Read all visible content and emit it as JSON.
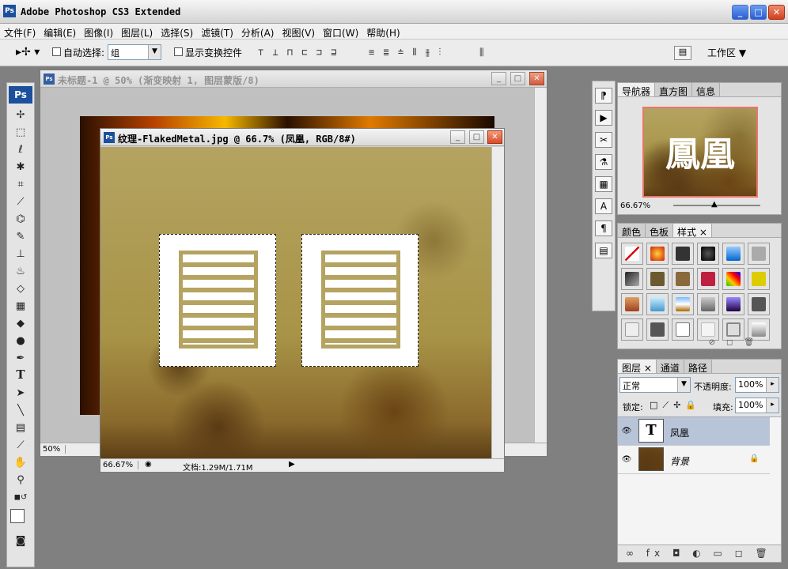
{
  "app": {
    "title": "Adobe Photoshop CS3 Extended",
    "logo": "Ps"
  },
  "window_controls": {
    "minimize": "_",
    "maximize": "□",
    "close": "✕"
  },
  "menu": [
    "文件(F)",
    "编辑(E)",
    "图像(I)",
    "图层(L)",
    "选择(S)",
    "滤镜(T)",
    "分析(A)",
    "视图(V)",
    "窗口(W)",
    "帮助(H)"
  ],
  "options": {
    "auto_select_label": "自动选择:",
    "auto_select_value": "组",
    "show_transform_label": "显示变换控件",
    "workspace_label": "工作区 ▼",
    "align_icons": "⊤ ⊥ ⊓  ⊏ ⊐ ⊒",
    "distribute_icons": "≡ ≣ ≐  ⫴ ⫵ ⫶"
  },
  "doc_back": {
    "title": "未标题-1 @ 50% (渐变映射 1, 图层蒙版/8)",
    "zoom": "50%"
  },
  "doc_front": {
    "title": "纹理-FlakedMetal.jpg @ 66.7% (凤凰, RGB/8#)",
    "zoom": "66.67%",
    "doc_info": "文档:1.29M/1.71M",
    "chars": [
      "凰",
      "凰"
    ]
  },
  "navigator": {
    "tabs": [
      "导航器",
      "直方图",
      "信息"
    ],
    "zoom": "66.67%",
    "thumb_text": "鳳凰"
  },
  "swatches_panel": {
    "tabs": [
      "颜色",
      "色板",
      "样式"
    ],
    "close_x": "×"
  },
  "layers_panel": {
    "tabs": [
      "图层",
      "通道",
      "路径"
    ],
    "close_x": "×",
    "blend_mode": "正常",
    "opacity_label": "不透明度:",
    "opacity_value": "100%",
    "lock_label": "锁定:",
    "fill_label": "填充:",
    "fill_value": "100%",
    "layers": [
      {
        "name": "凤凰",
        "thumb": "T"
      },
      {
        "name": "背景",
        "thumb": ""
      }
    ],
    "footer_icons": "∞ fx ◘ ◐ ▭ ◻ 🗑"
  },
  "colors": {
    "accent": "#1c4f9c",
    "selected_layer": "#b8c4d8",
    "nav_frame": "#e8766a"
  }
}
